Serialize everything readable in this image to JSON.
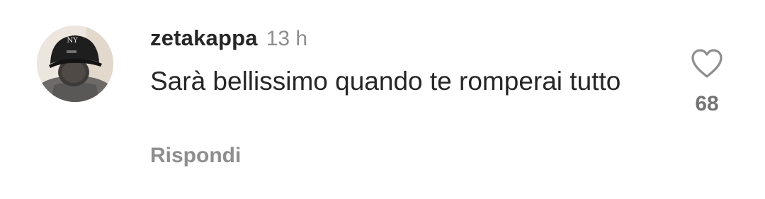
{
  "comment": {
    "username": "zetakappa",
    "timestamp": "13 h",
    "text": "Sarà bellissimo quando te romperai tutto",
    "reply_label": "Rispondi",
    "like_count": "68",
    "avatar_cap_logo": "NY"
  },
  "icons": {
    "like": "heart-outline-icon",
    "avatar": "user-avatar-photo"
  },
  "colors": {
    "primary_text": "#262626",
    "secondary_text": "#8e8e8e",
    "like_count": "#737373",
    "background": "#ffffff"
  }
}
